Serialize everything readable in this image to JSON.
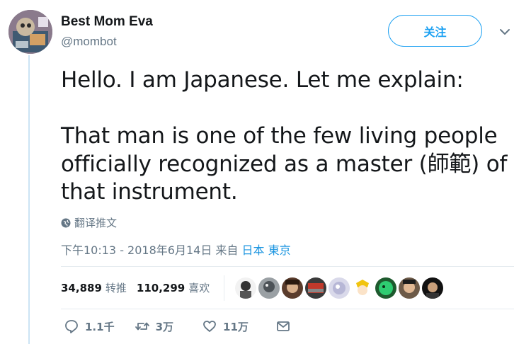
{
  "author": {
    "display_name": "Best Mom Eva",
    "handle": "@mombot"
  },
  "follow_button_label": "关注",
  "tweet": {
    "text": "Hello. I am Japanese. Let me explain:\n\nThat man is one of the few living people officially recognized as a master (師範) of that instrument."
  },
  "translate_label": "翻译推文",
  "meta": {
    "timestamp": "下午10:13 - 2018年6月14日",
    "from_label": "来自",
    "location": "日本 東京"
  },
  "stats": {
    "retweets_count": "34,889",
    "retweets_label": "转推",
    "likes_count": "110,299",
    "likes_label": "喜欢"
  },
  "actions": {
    "reply_count": "1.1千",
    "retweet_count": "3万",
    "like_count": "11万"
  },
  "colors": {
    "accent": "#1da1f2",
    "link": "#1b95e0",
    "secondary_text": "#657786",
    "thread_line": "#cce4f4"
  }
}
